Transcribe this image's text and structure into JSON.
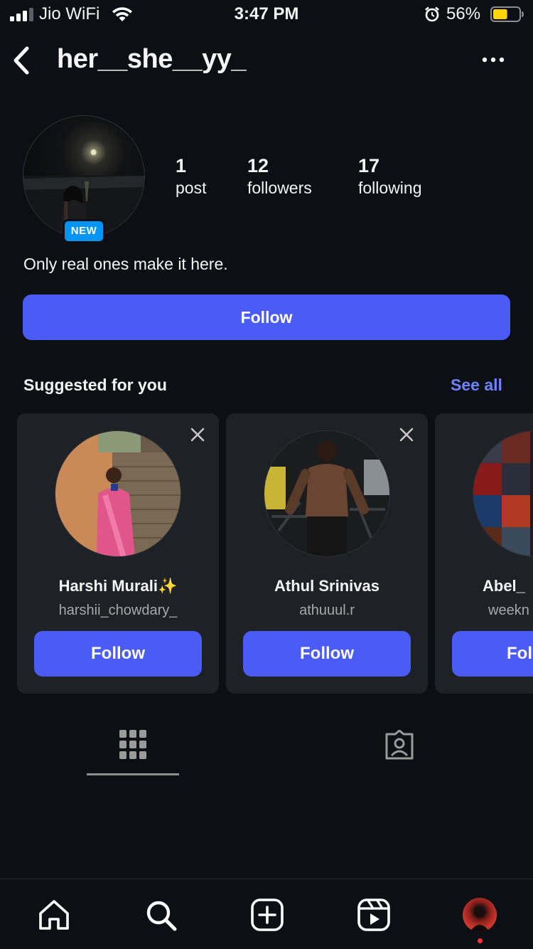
{
  "status_bar": {
    "carrier": "Jio WiFi",
    "time": "3:47 PM",
    "battery_percent": "56%",
    "battery_level": 0.56,
    "battery_color": "#ffd60a",
    "icons": [
      "signal-icon",
      "wifi-icon",
      "alarm-icon",
      "battery-icon"
    ]
  },
  "header": {
    "username": "her__she__yy_",
    "back_icon": "chevron-left-icon",
    "more_icon": "more-horizontal-icon"
  },
  "profile": {
    "badge": "NEW",
    "stats": [
      {
        "value": "1",
        "label": "post"
      },
      {
        "value": "12",
        "label": "followers"
      },
      {
        "value": "17",
        "label": "following"
      }
    ],
    "bio": "Only real ones make it here.",
    "follow_label": "Follow"
  },
  "suggestions": {
    "title": "Suggested for you",
    "see_all": "See all",
    "cards": [
      {
        "name": "Harshi Murali✨",
        "handle": "harshii_chowdary_",
        "button": "Follow"
      },
      {
        "name": "Athul Srinivas",
        "handle": "athuuul.r",
        "button": "Follow"
      },
      {
        "name": "Abel_",
        "handle": "weekn",
        "button": "Fol"
      }
    ]
  },
  "tabs": [
    "grid-icon",
    "tagged-icon"
  ],
  "bottom_nav": [
    "home-icon",
    "search-icon",
    "create-icon",
    "reels-icon",
    "profile-avatar"
  ],
  "colors": {
    "background": "#0c1014",
    "accent": "#4a5cf5",
    "link": "#6d83ff",
    "badge": "#0095f6",
    "card": "#1e2126"
  }
}
